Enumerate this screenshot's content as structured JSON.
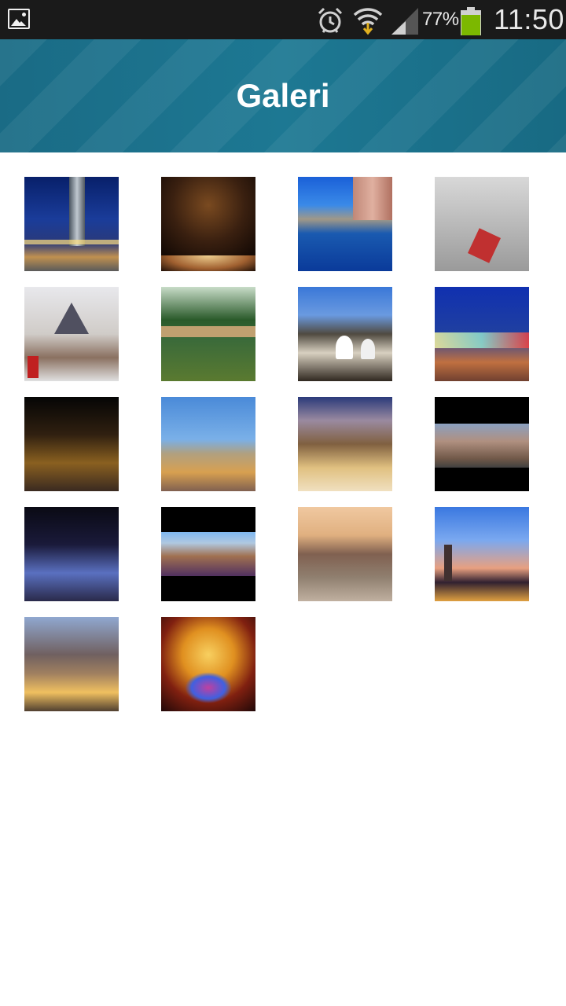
{
  "status_bar": {
    "battery_percent": "77%",
    "time": "11:50",
    "icons": [
      "gallery-notification-icon",
      "alarm-icon",
      "wifi-icon",
      "signal-icon",
      "battery-icon"
    ]
  },
  "header": {
    "title": "Galeri"
  },
  "gallery": {
    "items": [
      {
        "name": "tower-night"
      },
      {
        "name": "dome-ceremony"
      },
      {
        "name": "pond-buildings"
      },
      {
        "name": "foggy-tram"
      },
      {
        "name": "snowy-mosque"
      },
      {
        "name": "park-fountain"
      },
      {
        "name": "whirling-dervishes-outdoor"
      },
      {
        "name": "tram-night"
      },
      {
        "name": "street-night"
      },
      {
        "name": "terrace-restaurant"
      },
      {
        "name": "courtyard-dinner"
      },
      {
        "name": "city-panorama-letterbox"
      },
      {
        "name": "crowd-night-square"
      },
      {
        "name": "city-aerial-letterbox"
      },
      {
        "name": "city-boulevard"
      },
      {
        "name": "skyline-sunset"
      },
      {
        "name": "avenue-traffic"
      },
      {
        "name": "dervish-painting"
      }
    ]
  },
  "colors": {
    "status_bar": "#1a1a1a",
    "header": "#1d7893",
    "header_text": "#ffffff",
    "background": "#ffffff"
  }
}
